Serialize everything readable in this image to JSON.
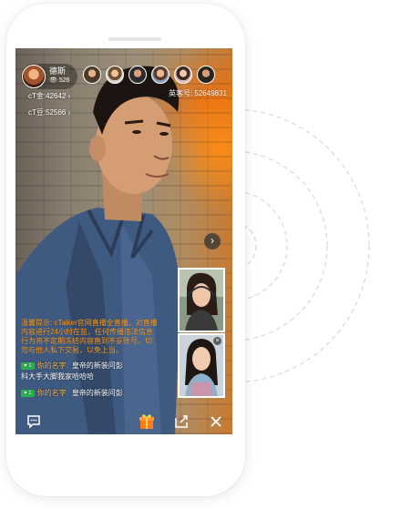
{
  "host": {
    "name": "德斯",
    "views": "526",
    "views_icon": "eye-icon"
  },
  "stats": {
    "coins": "cT金:42642",
    "beans": "cT豆:52566"
  },
  "room_id": "英客号: 52649831",
  "notice": "温馨提示: cTalker官网直播全直播。对直播内容进行24小时在监，任何传播违法信息行为将不定期冻结内容直到不妥账号。切勿与他人私下交易，以免上当。",
  "chat": [
    {
      "level": "1",
      "user": "你的名字:",
      "message": "皇帝的新装问彭"
    },
    {
      "level": "",
      "user": "",
      "message": "科大手大脚我家哈哈哈"
    },
    {
      "level": "1",
      "user": "你的名字:",
      "message": "皇帝的新装问彭"
    }
  ],
  "icons": {
    "chat": "chat-bubble-icon",
    "gift": "gift-icon",
    "share": "share-icon",
    "close": "close-icon",
    "next": "chevron-right-icon"
  },
  "colors": {
    "notice": "#ff9c1e",
    "username": "#ffb33a",
    "level_badge": "#27b34a",
    "gift": "#ff7a1a"
  }
}
